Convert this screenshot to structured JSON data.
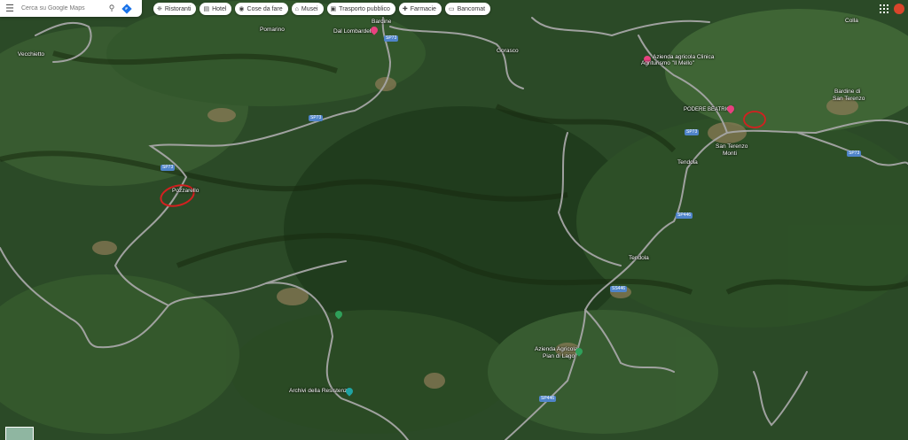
{
  "search": {
    "placeholder": "Cerca su Google Maps"
  },
  "chips": [
    {
      "icon": "fork-knife-icon",
      "glyph": "❈",
      "label": "Ristoranti"
    },
    {
      "icon": "hotel-bed-icon",
      "glyph": "▤",
      "label": "Hotel"
    },
    {
      "icon": "camera-icon",
      "glyph": "◉",
      "label": "Cose da fare"
    },
    {
      "icon": "museum-icon",
      "glyph": "⌂",
      "label": "Musei"
    },
    {
      "icon": "train-icon",
      "glyph": "▣",
      "label": "Trasporto pubblico"
    },
    {
      "icon": "pharmacy-icon",
      "glyph": "✚",
      "label": "Farmacie"
    },
    {
      "icon": "atm-icon",
      "glyph": "▭",
      "label": "Bancomat"
    }
  ],
  "places": {
    "vecchietto": "Vecchietto",
    "pomarino": "Pomarino",
    "bardine": "Bardine",
    "dal_lombardello": "Dal Lombardello",
    "gorasco": "Gorasco",
    "azienda_clinica_1": "Azienda agricola Clinica",
    "azienda_clinica_2": "Agriturismo \"Il Mello\"",
    "podere_beatrice": "PODERE BEATRICE",
    "san_terenzo_1": "San Terenzo",
    "san_terenzo_2": "Monti",
    "tendola_1": "Tendola",
    "tendola_2": "Tendola",
    "bardine_st_1": "Bardine di",
    "bardine_st_2": "San Terenzo",
    "colla": "Colla",
    "pozzarello": "Pozzarello",
    "azienda_pian_1": "Azienda Agricola",
    "azienda_pian_2": "Pian di Lago",
    "archivi": "Archivi della Resistenza"
  },
  "roads": [
    "SP73",
    "SP73",
    "SP73",
    "SP73",
    "SP446",
    "SS446",
    "SP446",
    "SP73"
  ],
  "colors": {
    "red_annotation": "#d32020",
    "road": "#9a9a9a",
    "poi_pink": "#e8417f",
    "poi_green": "#2fa05a",
    "poi_teal": "#20a3a3",
    "shield": "#4f84c9"
  }
}
